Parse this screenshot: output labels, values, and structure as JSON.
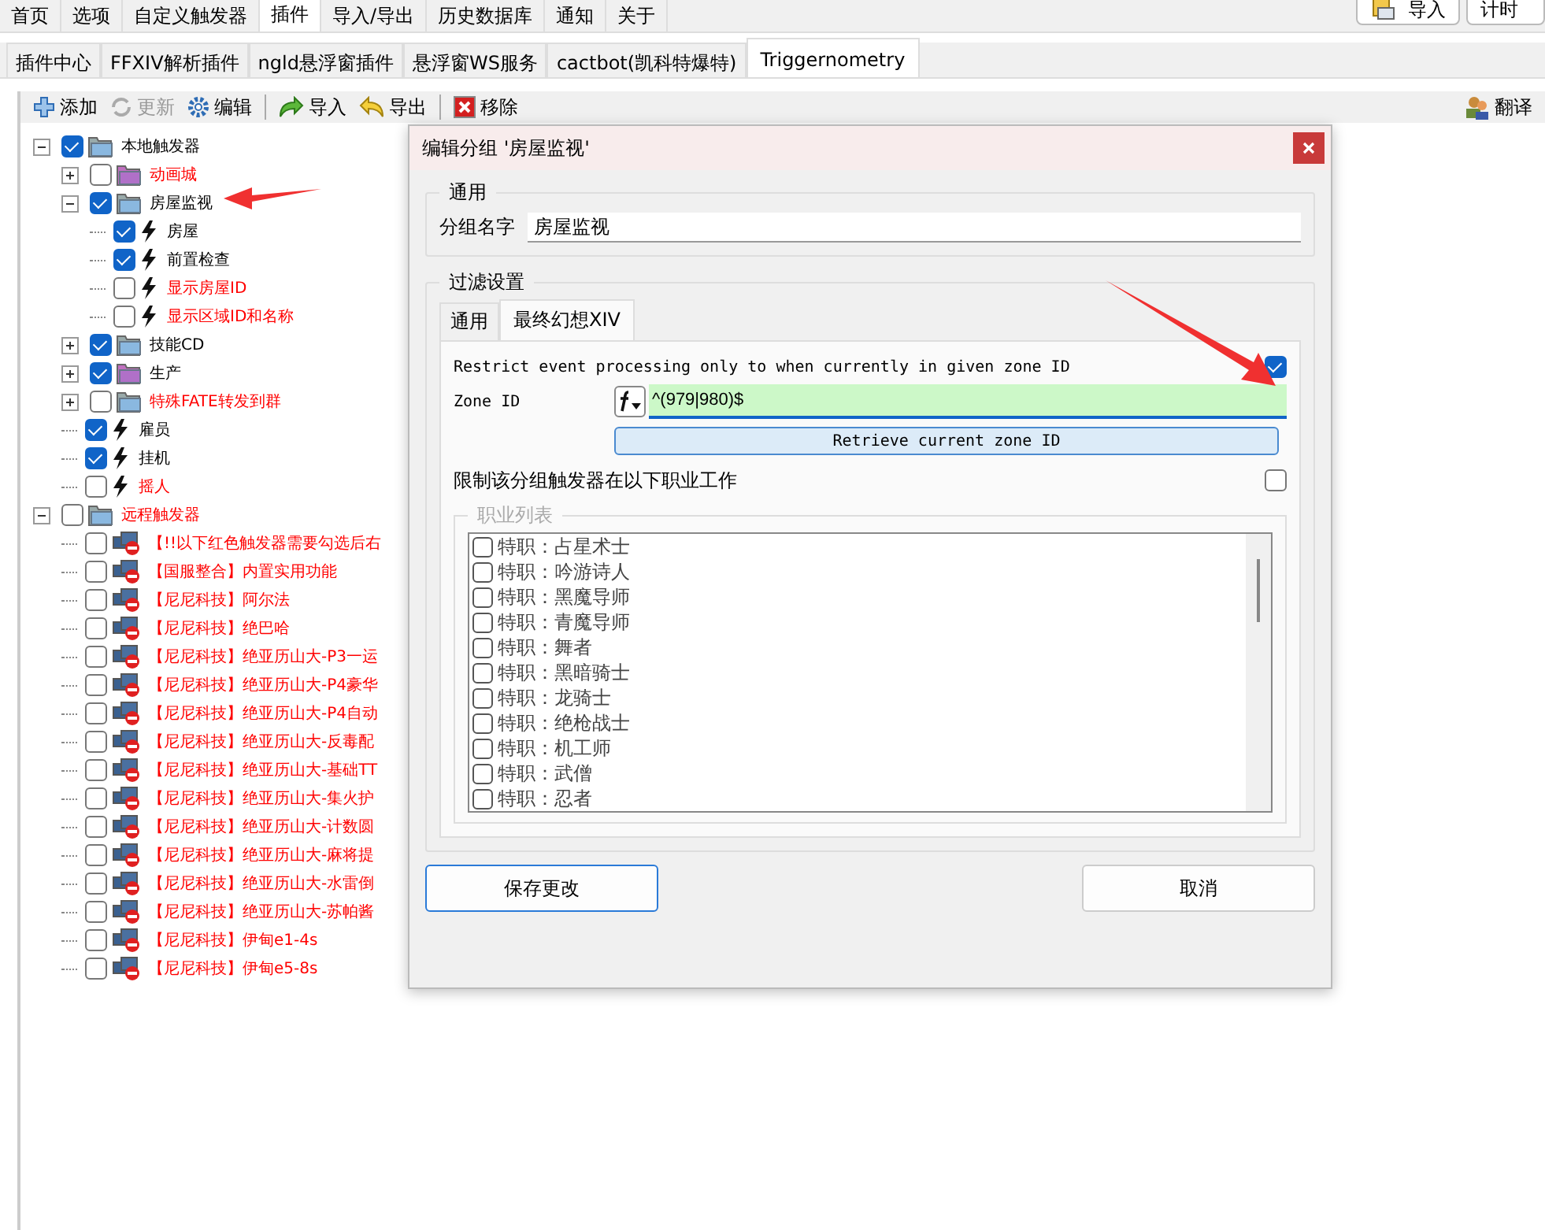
{
  "main_tabs": [
    {
      "label": "首页",
      "selected": false
    },
    {
      "label": "选项",
      "selected": false
    },
    {
      "label": "自定义触发器",
      "selected": false
    },
    {
      "label": "插件",
      "selected": true
    },
    {
      "label": "导入/导出",
      "selected": false
    },
    {
      "label": "历史数据库",
      "selected": false
    },
    {
      "label": "通知",
      "selected": false
    },
    {
      "label": "关于",
      "selected": false
    }
  ],
  "corner_buttons": [
    "导入",
    "计时"
  ],
  "plugin_tabs": [
    {
      "label": "插件中心",
      "selected": false
    },
    {
      "label": "FFXIV解析插件",
      "selected": false
    },
    {
      "label": "ngld悬浮窗插件",
      "selected": false
    },
    {
      "label": "悬浮窗WS服务",
      "selected": false
    },
    {
      "label": "cactbot(凯科特爆特)",
      "selected": false
    },
    {
      "label": "Triggernometry",
      "selected": true
    }
  ],
  "toolbar": [
    {
      "kind": "add",
      "label": "添加",
      "disabled": false
    },
    {
      "kind": "refresh",
      "label": "更新",
      "disabled": true
    },
    {
      "kind": "edit",
      "label": "编辑",
      "disabled": false
    },
    {
      "kind": "import",
      "label": "导入",
      "disabled": false
    },
    {
      "kind": "export",
      "label": "导出",
      "disabled": false
    },
    {
      "kind": "remove",
      "label": "移除",
      "disabled": false
    }
  ],
  "translate_button": "翻译",
  "tree": [
    {
      "label": "本地触发器",
      "kind": "folder",
      "checked": true,
      "expanded": true,
      "color": "#000000",
      "children": [
        {
          "label": "动画城",
          "kind": "purplefolder",
          "checked": false,
          "expanded": false,
          "color": "#ff0000"
        },
        {
          "label": "房屋监视",
          "kind": "folder",
          "checked": true,
          "expanded": true,
          "color": "#000000",
          "children": [
            {
              "label": "房屋",
              "kind": "trigger",
              "checked": true,
              "color": "#000000"
            },
            {
              "label": "前置检查",
              "kind": "trigger",
              "checked": true,
              "color": "#000000"
            },
            {
              "label": "显示房屋ID",
              "kind": "trigger",
              "checked": false,
              "color": "#ff0000"
            },
            {
              "label": "显示区域ID和名称",
              "kind": "trigger",
              "checked": false,
              "color": "#ff0000"
            }
          ]
        },
        {
          "label": "技能CD",
          "kind": "folder",
          "checked": true,
          "expanded": false,
          "color": "#000000"
        },
        {
          "label": "生产",
          "kind": "purplefolder",
          "checked": true,
          "expanded": false,
          "color": "#000000"
        },
        {
          "label": "特殊FATE转发到群",
          "kind": "folder",
          "checked": false,
          "expanded": false,
          "color": "#ff0000"
        },
        {
          "label": "雇员",
          "kind": "trigger",
          "checked": true,
          "color": "#000000"
        },
        {
          "label": "挂机",
          "kind": "trigger",
          "checked": true,
          "color": "#000000"
        },
        {
          "label": "摇人",
          "kind": "trigger",
          "checked": false,
          "color": "#ff0000"
        }
      ]
    },
    {
      "label": "远程触发器",
      "kind": "folder",
      "checked": false,
      "expanded": true,
      "color": "#ff0000",
      "children": [
        {
          "label": "【!!以下红色触发器需要勾选后右",
          "kind": "remote",
          "checked": false,
          "color": "#ff0000"
        },
        {
          "label": "【国服整合】内置实用功能",
          "kind": "remote",
          "checked": false,
          "color": "#ff0000"
        },
        {
          "label": "【尼尼科技】阿尔法",
          "kind": "remote",
          "checked": false,
          "color": "#ff0000"
        },
        {
          "label": "【尼尼科技】绝巴哈",
          "kind": "remote",
          "checked": false,
          "color": "#ff0000"
        },
        {
          "label": "【尼尼科技】绝亚历山大-P3一运",
          "kind": "remote",
          "checked": false,
          "color": "#ff0000"
        },
        {
          "label": "【尼尼科技】绝亚历山大-P4豪华",
          "kind": "remote",
          "checked": false,
          "color": "#ff0000"
        },
        {
          "label": "【尼尼科技】绝亚历山大-P4自动",
          "kind": "remote",
          "checked": false,
          "color": "#ff0000"
        },
        {
          "label": "【尼尼科技】绝亚历山大-反毒配",
          "kind": "remote",
          "checked": false,
          "color": "#ff0000"
        },
        {
          "label": "【尼尼科技】绝亚历山大-基础TT",
          "kind": "remote",
          "checked": false,
          "color": "#ff0000"
        },
        {
          "label": "【尼尼科技】绝亚历山大-集火护",
          "kind": "remote",
          "checked": false,
          "color": "#ff0000"
        },
        {
          "label": "【尼尼科技】绝亚历山大-计数圆",
          "kind": "remote",
          "checked": false,
          "color": "#ff0000"
        },
        {
          "label": "【尼尼科技】绝亚历山大-麻将提",
          "kind": "remote",
          "checked": false,
          "color": "#ff0000"
        },
        {
          "label": "【尼尼科技】绝亚历山大-水雷倒",
          "kind": "remote",
          "checked": false,
          "color": "#ff0000"
        },
        {
          "label": "【尼尼科技】绝亚历山大-苏帕酱",
          "kind": "remote",
          "checked": false,
          "color": "#ff0000"
        },
        {
          "label": "【尼尼科技】伊甸e1-4s",
          "kind": "remote",
          "checked": false,
          "color": "#ff0000"
        },
        {
          "label": "【尼尼科技】伊甸e5-8s",
          "kind": "remote",
          "checked": false,
          "color": "#ff0000"
        }
      ]
    }
  ],
  "dialog": {
    "title": "编辑分组 '房屋监视'",
    "general_title": "通用",
    "name_label": "分组名字",
    "name_value": "房屋监视",
    "filter_title": "过滤设置",
    "tabs": [
      {
        "label": "通用",
        "selected": false
      },
      {
        "label": "最终幻想XIV",
        "selected": true
      }
    ],
    "zone_restrict": {
      "label": "Restrict event processing only to when currently in given zone ID",
      "checked": true
    },
    "zone_id_label": "Zone ID",
    "zone_id_value": "^(979|980)$",
    "retrieve_button": "Retrieve current zone ID",
    "job_restrict": {
      "label": "限制该分组触发器在以下职业工作",
      "checked": false
    },
    "job_list_title": "职业列表",
    "jobs": [
      {
        "label": "特职：占星术士",
        "checked": false
      },
      {
        "label": "特职：吟游诗人",
        "checked": false
      },
      {
        "label": "特职：黑魔导师",
        "checked": false
      },
      {
        "label": "特职：青魔导师",
        "checked": false
      },
      {
        "label": "特职：舞者",
        "checked": false
      },
      {
        "label": "特职：黑暗骑士",
        "checked": false
      },
      {
        "label": "特职：龙骑士",
        "checked": false
      },
      {
        "label": "特职：绝枪战士",
        "checked": false
      },
      {
        "label": "特职：机工师",
        "checked": false
      },
      {
        "label": "特职：武僧",
        "checked": false
      },
      {
        "label": "特职：忍者",
        "checked": false
      }
    ],
    "save_button": "保存更改",
    "cancel_button": "取消"
  }
}
